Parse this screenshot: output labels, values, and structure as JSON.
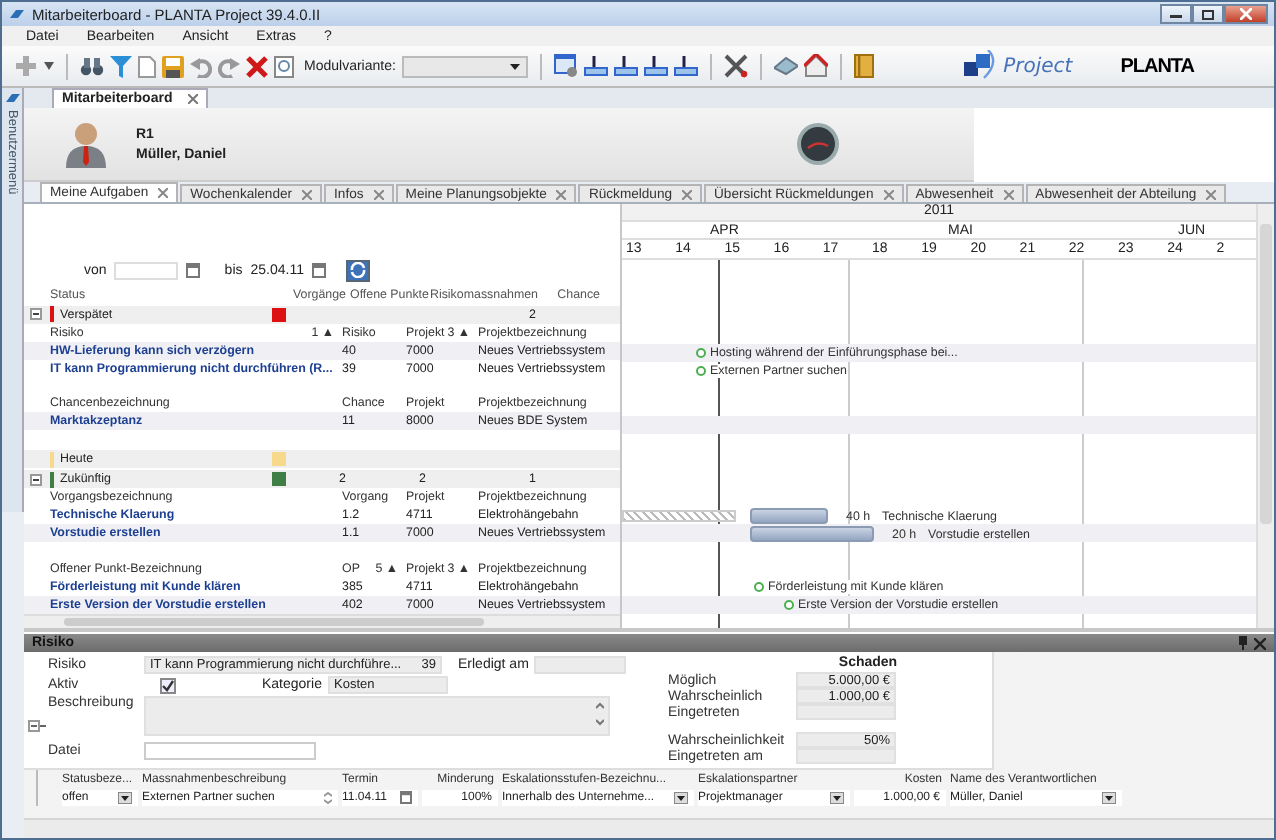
{
  "window": {
    "title": "Mitarbeiterboard - PLANTA Project 39.4.0.II"
  },
  "menu": [
    {
      "label": "Datei"
    },
    {
      "label": "Bearbeiten"
    },
    {
      "label": "Ansicht"
    },
    {
      "label": "Extras"
    },
    {
      "label": "?"
    }
  ],
  "toolbar": {
    "module_variant_label": "Modulvariante:"
  },
  "logos": {
    "project": "Project",
    "planta": "PLANTA"
  },
  "side_panel": {
    "label": "Benutzermenü"
  },
  "module_tab": {
    "label": "Mitarbeiterboard"
  },
  "user": {
    "code": "R1",
    "name": "Müller, Daniel"
  },
  "tabs": [
    {
      "label": "Meine Aufgaben",
      "selected": true
    },
    {
      "label": "Wochenkalender",
      "selected": false
    },
    {
      "label": "Infos",
      "selected": false
    },
    {
      "label": "Meine Planungsobjekte",
      "selected": false
    },
    {
      "label": "Rückmeldung",
      "selected": false
    },
    {
      "label": "Übersicht Rückmeldungen",
      "selected": false
    },
    {
      "label": "Abwesenheit",
      "selected": false
    },
    {
      "label": "Abwesenheit der Abteilung",
      "selected": false
    }
  ],
  "filter": {
    "from_label": "von",
    "to_label": "bis",
    "to_value": "25.04.11"
  },
  "summary": {
    "columns": [
      "Status",
      "Vorgänge",
      "Offene Punkte",
      "Risikomassnahmen",
      "Chance"
    ],
    "groups": [
      {
        "status": "Verspätet",
        "color": "#dd1111",
        "expanded": true,
        "counts": {
          "risk_measures": "2"
        },
        "tables": [
          {
            "columns": [
              {
                "label": "Risiko",
                "sort": "1 ▲"
              },
              {
                "label": "Risiko"
              },
              {
                "label": "Projekt",
                "sort": "3 ▲"
              },
              {
                "label": "Projektbezeichnung"
              }
            ],
            "rows": [
              {
                "cells": [
                  "HW-Lieferung kann sich verzögern",
                  "40",
                  "7000",
                  "Neues Vertriebssystem"
                ],
                "gantt": {
                  "kind": "milestone",
                  "label": "Hosting während der Einführungsphase bei..."
                }
              },
              {
                "cells": [
                  "IT kann Programmierung nicht durchführen (R...",
                  "39",
                  "7000",
                  "Neues Vertriebssystem"
                ],
                "gantt": {
                  "kind": "milestone",
                  "label": "Externen Partner suchen"
                }
              }
            ]
          },
          {
            "columns": [
              {
                "label": "Chancenbezeichnung"
              },
              {
                "label": "Chance"
              },
              {
                "label": "Projekt"
              },
              {
                "label": "Projektbezeichnung"
              }
            ],
            "rows": [
              {
                "cells": [
                  "Marktakzeptanz",
                  "11",
                  "8000",
                  "Neues BDE System"
                ]
              }
            ]
          }
        ]
      },
      {
        "status": "Heute",
        "color": "#f7d98c"
      },
      {
        "status": "Zukünftig",
        "color": "#3f7f45",
        "expanded": true,
        "counts": {
          "tasks": "2",
          "open_points": "2",
          "risk_measures": "1"
        },
        "tables": [
          {
            "columns": [
              {
                "label": "Vorgangsbezeichnung"
              },
              {
                "label": "Vorgang"
              },
              {
                "label": "Projekt"
              },
              {
                "label": "Projektbezeichnung"
              }
            ],
            "rows": [
              {
                "cells": [
                  "Technische Klaerung",
                  "1.2",
                  "4711",
                  "Elektrohängebahn"
                ],
                "gantt": {
                  "kind": "bar",
                  "hours": "40 h",
                  "label": "Technische Klaerung",
                  "overdue": true
                }
              },
              {
                "cells": [
                  "Vorstudie erstellen",
                  "1.1",
                  "7000",
                  "Neues Vertriebssystem"
                ],
                "gantt": {
                  "kind": "bar",
                  "hours": "20 h",
                  "label": "Vorstudie erstellen",
                  "overdue": false
                }
              }
            ]
          },
          {
            "columns": [
              {
                "label": "Offener Punkt-Bezeichnung"
              },
              {
                "label": "OP",
                "sort": "5 ▲"
              },
              {
                "label": "Projekt",
                "sort": "3 ▲"
              },
              {
                "label": "Projektbezeichnung"
              }
            ],
            "rows": [
              {
                "cells": [
                  "Förderleistung mit Kunde klären",
                  "385",
                  "4711",
                  "Elektrohängebahn"
                ],
                "gantt": {
                  "kind": "milestone",
                  "label": "Förderleistung mit Kunde klären"
                }
              },
              {
                "cells": [
                  "Erste Version der Vorstudie erstellen",
                  "402",
                  "7000",
                  "Neues Vertriebssystem"
                ],
                "gantt": {
                  "kind": "milestone",
                  "label": "Erste Version der Vorstudie erstellen"
                }
              }
            ]
          }
        ]
      }
    ]
  },
  "gantt": {
    "year": "2011",
    "months": [
      "APR",
      "MAI",
      "JUN"
    ],
    "weeks": [
      "13",
      "14",
      "15",
      "16",
      "17",
      "18",
      "19",
      "20",
      "21",
      "22",
      "23",
      "24",
      "2"
    ]
  },
  "detail": {
    "title": "Risiko",
    "expanded": true,
    "risk": {
      "label": "Risiko",
      "value": "IT kann Programmierung nicht durchführe...",
      "number": "39"
    },
    "done_on": {
      "label": "Erledigt am"
    },
    "active": {
      "label": "Aktiv",
      "checked": true
    },
    "category": {
      "label": "Kategorie",
      "value": "Kosten"
    },
    "description": {
      "label": "Beschreibung"
    },
    "file": {
      "label": "Datei"
    },
    "damage": {
      "title": "Schaden",
      "rows": [
        {
          "label": "Möglich",
          "value": "5.000,00 €"
        },
        {
          "label": "Wahrscheinlich",
          "value": "1.000,00 €"
        },
        {
          "label": "Eingetreten"
        }
      ]
    },
    "probability": {
      "label": "Wahrscheinlichkeit",
      "value": "50%"
    },
    "occurred_on": {
      "label": "Eingetreten am"
    },
    "measures": {
      "columns": [
        "Statusbeze...",
        "Massnahmenbeschreibung",
        "Termin",
        "Minderung",
        "Eskalationsstufen-Bezeichnu...",
        "Eskalationspartner",
        "Kosten",
        "Name des Verantwortlichen"
      ],
      "rows": [
        {
          "status": "offen",
          "description": "Externen Partner suchen",
          "date": "11.04.11",
          "reduction": "100%",
          "escalation_level": "Innerhalb des Unternehme...",
          "escalation_partner": "Projektmanager",
          "costs": "1.000,00 €",
          "responsible": "Müller, Daniel"
        }
      ]
    }
  }
}
